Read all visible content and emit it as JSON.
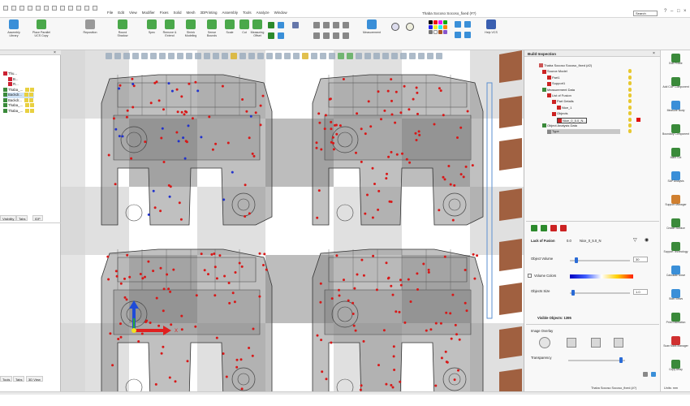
{
  "titlebar": {
    "title": "Thaba Socoso Socoso_fixed (#?)",
    "search_placeholder": "Search",
    "menu": [
      "File",
      "Edit",
      "View",
      "Modifier",
      "Fixes",
      "Solid",
      "Mesh",
      "3DPrinting",
      "Assembly",
      "Tools",
      "Analyze",
      "Window"
    ]
  },
  "ribbon": {
    "buttons": [
      {
        "label": "Assembly Library",
        "color": "#3a8fd8"
      },
      {
        "label": "Place Parallel UCS Copy",
        "color": "#4aa84a"
      },
      {
        "label": "Reposition",
        "color": "#999999"
      },
      {
        "label": "Round Shadow",
        "color": "#4aa84a"
      },
      {
        "label": "Spec",
        "color": "#4aa84a"
      },
      {
        "label": "Remove & Extend",
        "color": "#4aa84a"
      },
      {
        "label": "Shrink Modeling",
        "color": "#4aa84a"
      },
      {
        "label": "Sense Bounds",
        "color": "#4aa84a"
      },
      {
        "label": "Scale",
        "color": "#4aa84a"
      },
      {
        "label": "Cut",
        "color": "#4aa84a"
      },
      {
        "label": "Measuring Offset",
        "color": "#4aa84a"
      },
      {
        "label": "Measurement",
        "color": "#3a8fd8"
      },
      {
        "label": "Help VCS",
        "color": "#3a5fb0"
      }
    ]
  },
  "left_panel": {
    "tree": [
      "Thu...",
      "B...",
      "R...",
      "Thaba_...",
      "Backdr...",
      "Backdr...",
      "Thaba_...",
      "Thaba_..."
    ],
    "tabs_mid": [
      "Visibility",
      "Tabs",
      "IDP"
    ],
    "tabs_bottom": [
      "Tools",
      "Tabs",
      "3D View"
    ]
  },
  "right_panel": {
    "title": "Build Inspection",
    "tree": [
      "Thaba Socoso Socoso_fixed (#2)",
      "Source Model",
      "Part1",
      "Support1",
      "Measurement Data",
      "List of Fusion",
      "Part Details",
      "Nice_1",
      "Objects",
      "Nice_0_5.0_N...",
      "Object Analysis Data",
      "Type"
    ],
    "section_label": "Lack of Fusion",
    "section_value": "0.0",
    "section_item": "Nice_0_5.0_N",
    "object_volume_label": "Object Volume",
    "object_volume_value": "30",
    "volume_colors_label": "Volume Colors",
    "objects_size_label": "Objects Size",
    "objects_size_value": "1.0",
    "visible_objects": "Visible Objects: 1395",
    "image_overlay_label": "Image Overlay",
    "transparency_label": "Transparency"
  },
  "far_right": {
    "items": [
      "Edit Profile",
      "Add CAP Component",
      "Measure Body",
      "Boundary Component",
      "Mark Cut",
      "SAP Analysis",
      "Support Manager",
      "Create Surface",
      "Support Technology",
      "Calculate Move",
      "Start Views",
      "Print Estimation",
      "Scan Mark Manager",
      "Copy Array"
    ]
  },
  "viewport": {
    "axis_x_label": "X"
  },
  "status": {
    "model": "Thaba Socoso Socoso_fixed (#?)",
    "units": "Units: mm"
  }
}
